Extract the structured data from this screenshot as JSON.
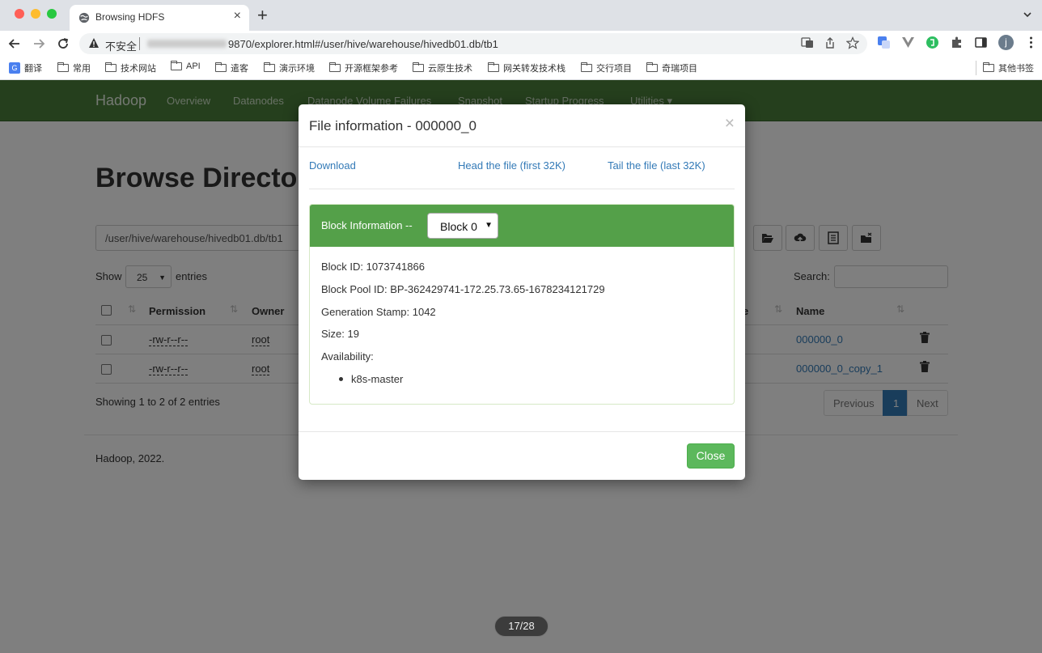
{
  "browser": {
    "tab_title": "Browsing HDFS",
    "insecure_label": "不安全",
    "url_visible": "9870/explorer.html#/user/hive/warehouse/hivedb01.db/tb1",
    "bookmarks": [
      "翻译",
      "常用",
      "技术网站",
      "API",
      "遣客",
      "演示环境",
      "开源框架参考",
      "云原生技术",
      "网关转发技术栈",
      "交行项目",
      "奇瑞项目"
    ],
    "other_bookmarks": "其他书签",
    "profile_initial": "j"
  },
  "navbar": {
    "brand": "Hadoop",
    "links": [
      "Overview",
      "Datanodes",
      "Datanode Volume Failures",
      "Snapshot",
      "Startup Progress",
      "Utilities ▾"
    ]
  },
  "page": {
    "title": "Browse Director",
    "path": "/user/hive/warehouse/hivedb01.db/tb1",
    "show_label": "Show",
    "page_size": "25",
    "entries_label": "entries",
    "search_label": "Search:",
    "columns": [
      "Permission",
      "Owner",
      "e",
      "Name"
    ],
    "rows": [
      {
        "permission": "-rw-r--r--",
        "owner": "root",
        "name": "000000_0"
      },
      {
        "permission": "-rw-r--r--",
        "owner": "root",
        "name": "000000_0_copy_1"
      }
    ],
    "showing_text": "Showing 1 to 2 of 2 entries",
    "pagination": {
      "previous": "Previous",
      "current": "1",
      "next": "Next"
    },
    "footer": "Hadoop, 2022."
  },
  "modal": {
    "title": "File information - 000000_0",
    "close_x": "×",
    "links": {
      "download": "Download",
      "head": "Head the file (first 32K)",
      "tail": "Tail the file (last 32K)"
    },
    "block_info_label": "Block Information --",
    "block_selected": "Block 0",
    "block_id": "Block ID: 1073741866",
    "block_pool_id": "Block Pool ID: BP-362429741-172.25.73.65-1678234121729",
    "generation_stamp": "Generation Stamp: 1042",
    "size": "Size: 19",
    "availability_label": "Availability:",
    "availability_hosts": [
      "k8s-master"
    ],
    "close_button": "Close"
  },
  "slide_counter": "17/28"
}
